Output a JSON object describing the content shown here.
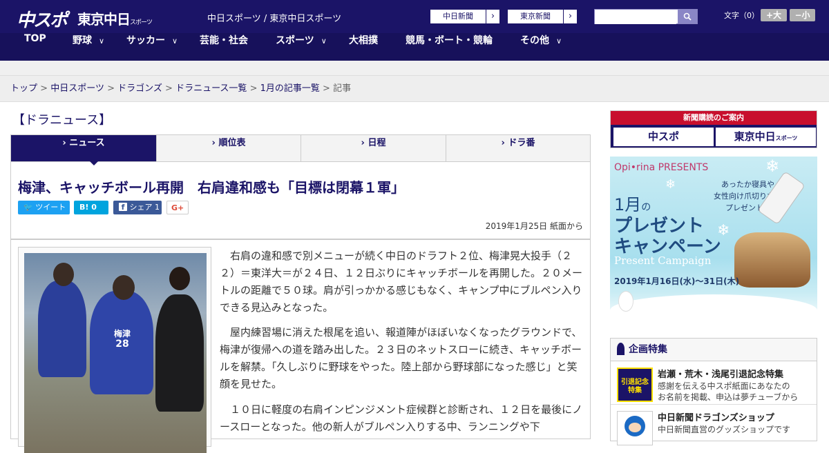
{
  "header": {
    "logo_chunichi_sports": "中スポ",
    "logo_tokyo_chunichi": "東京中日",
    "logo_tokyo_chunichi_sub": "スポーツ",
    "site_links": "中日スポーツ / 東京中日スポーツ",
    "btn_chunichi_shimbun": "中日新聞",
    "btn_tokyo_shimbun": "東京新聞",
    "search_placeholder": "",
    "font_size_label": "文字（0）",
    "font_bigger": "+大",
    "font_smaller": "−小"
  },
  "nav": [
    {
      "label": "TOP",
      "has_dropdown": false
    },
    {
      "label": "野球",
      "has_dropdown": true
    },
    {
      "label": "サッカー",
      "has_dropdown": true
    },
    {
      "label": "芸能・社会",
      "has_dropdown": false
    },
    {
      "label": "スポーツ",
      "has_dropdown": true
    },
    {
      "label": "大相撲",
      "has_dropdown": false
    },
    {
      "label": "競馬・ボート・競輪",
      "has_dropdown": false
    },
    {
      "label": "その他",
      "has_dropdown": true
    }
  ],
  "breadcrumb": {
    "items": [
      "トップ",
      "中日スポーツ",
      "ドラゴンズ",
      "ドラニュース一覧",
      "1月の記事一覧"
    ],
    "current": "記事",
    "separator": ">"
  },
  "section_title": "【ドラニュース】",
  "tabs": [
    {
      "label": "ニュース",
      "active": true
    },
    {
      "label": "順位表",
      "active": false
    },
    {
      "label": "日程",
      "active": false
    },
    {
      "label": "ドラ番",
      "active": false
    }
  ],
  "article": {
    "headline": "梅津、キャッチボール再開　右肩違和感も「目標は閉幕１軍」",
    "share": {
      "tweet": "ツイート",
      "hatena_count": "0",
      "facebook": "シェア",
      "facebook_count": "1",
      "google_plus": "G+"
    },
    "date": "2019年1月25日 紙面から",
    "photo_bib_name": "梅津",
    "photo_bib_number": "28",
    "paragraphs": [
      "　右肩の違和感で別メニューが続く中日のドラフト２位、梅津晃大投手（２２）＝東洋大＝が２４日、１２日ぶりにキャッチボールを再開した。２０メートルの距離で５０球。肩が引っかかる感じもなく、キャンプ中にブルペン入りできる見込みとなった。",
      "　屋内練習場に消えた根尾を追い、報道陣がほぼいなくなったグラウンドで、梅津が復帰への道を踏み出した。２３日のネットスローに続き、キャッチボールを解禁。「久しぶりに野球をやった。陸上部から野球部になった感じ」と笑顔を見せた。",
      "　１０日に軽度の右肩インピンジメント症候群と診断され、１２日を最後にノースローとなった。他の新人がブルペン入りする中、ランニングや下"
    ]
  },
  "sidebar": {
    "subscription": {
      "title": "新聞購読のご案内",
      "logo_left": "中スポ",
      "logo_right": "東京中日",
      "logo_right_sub": "スポーツ"
    },
    "ad": {
      "brand": "Opi•rina PRESENTS",
      "tagline": "あったか寝具や\n女性向け爪切りなど\nプレゼント★",
      "month": "1月",
      "month_suffix": "の",
      "title_line1": "プレゼント",
      "title_line2": "キャンペーン",
      "title_en": "Present Campaign",
      "period": "2019年1月16日(水)〜31日(木)"
    },
    "feature": {
      "heading": "企画特集",
      "items": [
        {
          "title": "岩瀬・荒木・浅尾引退記念特集",
          "desc": "感謝を伝える中スポ紙面にあなたの\nお名前を掲載、申込は夢チューブから",
          "thumb_text": "引退記念特集"
        },
        {
          "title": "中日新聞ドラゴンズショップ",
          "desc": "中日新聞直営のグッズショップです",
          "thumb_text": ""
        }
      ]
    }
  },
  "colors": {
    "brand_navy": "#1b1467",
    "nav_navy": "#17115b",
    "twitter": "#1da1f2",
    "hatena": "#00a4de",
    "facebook": "#3b5998",
    "gplus": "#dd4b39",
    "subscription_red": "#c80f2d"
  }
}
